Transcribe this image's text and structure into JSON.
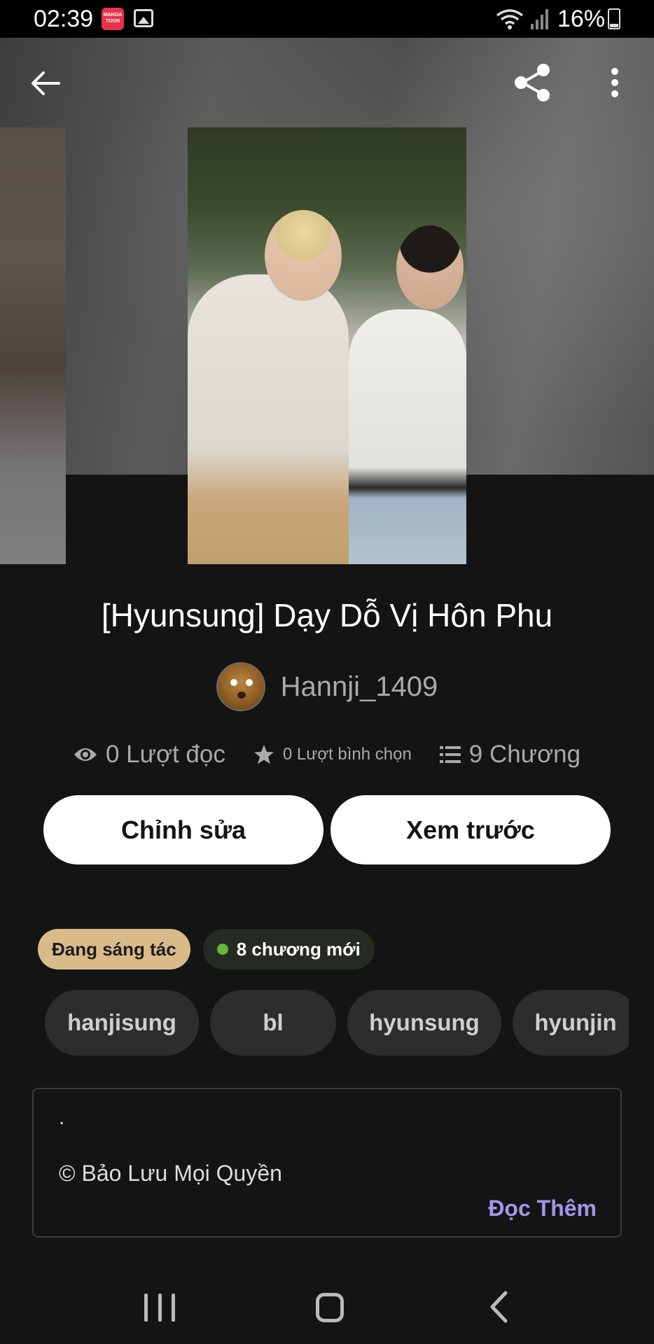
{
  "status_bar": {
    "time": "02:39",
    "app_icon_text": "MANGA TOON",
    "battery": "16%"
  },
  "header": {
    "icons": [
      "back-arrow-icon",
      "share-icon",
      "more-vert-icon"
    ]
  },
  "book": {
    "title": "[Hyunsung] Dạy Dỗ Vị Hôn Phu",
    "author": "Hannji_1409",
    "stats": {
      "reads": "0 Lượt đọc",
      "votes": "0 Lượt bình chọn",
      "chapters": "9 Chương"
    }
  },
  "actions": {
    "edit_label": "Chỉnh sửa",
    "preview_label": "Xem trước"
  },
  "badges": {
    "status": "Đang sáng tác",
    "new_chapters": "8 chương mới",
    "new_dot_color": "#6ab33c"
  },
  "tags": [
    "hanjisung",
    "bl",
    "hyunsung",
    "hyunjin"
  ],
  "description": {
    "line1": ".",
    "line2": "© Bảo Lưu Mọi Quyền",
    "read_more": "Đọc Thêm",
    "read_more_color": "#a595e8"
  }
}
